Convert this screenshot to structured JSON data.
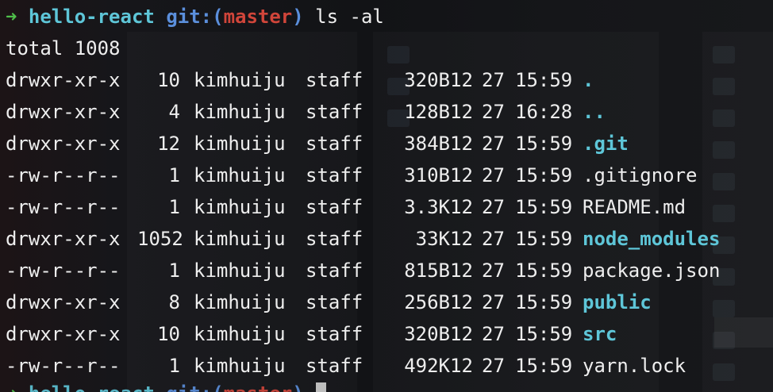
{
  "prompt": {
    "arrow": "➜",
    "dir": "hello-react",
    "git_prefix": "git:(",
    "branch": "master",
    "git_suffix": ")",
    "command": "ls -al"
  },
  "total_line": "total 1008",
  "entries": [
    {
      "perm": "drwxr-xr-x",
      "links": "10",
      "user": "kimhuiju",
      "group": "staff",
      "size": "320B",
      "month": "12",
      "day": "27",
      "time": "15:59",
      "name": "."
    },
    {
      "perm": "drwxr-xr-x",
      "links": "4",
      "user": "kimhuiju",
      "group": "staff",
      "size": "128B",
      "month": "12",
      "day": "27",
      "time": "16:28",
      "name": ".."
    },
    {
      "perm": "drwxr-xr-x",
      "links": "12",
      "user": "kimhuiju",
      "group": "staff",
      "size": "384B",
      "month": "12",
      "day": "27",
      "time": "15:59",
      "name": ".git"
    },
    {
      "perm": "-rw-r--r--",
      "links": "1",
      "user": "kimhuiju",
      "group": "staff",
      "size": "310B",
      "month": "12",
      "day": "27",
      "time": "15:59",
      "name": ".gitignore"
    },
    {
      "perm": "-rw-r--r--",
      "links": "1",
      "user": "kimhuiju",
      "group": "staff",
      "size": "3.3K",
      "month": "12",
      "day": "27",
      "time": "15:59",
      "name": "README.md"
    },
    {
      "perm": "drwxr-xr-x",
      "links": "1052",
      "user": "kimhuiju",
      "group": "staff",
      "size": "33K",
      "month": "12",
      "day": "27",
      "time": "15:59",
      "name": "node_modules"
    },
    {
      "perm": "-rw-r--r--",
      "links": "1",
      "user": "kimhuiju",
      "group": "staff",
      "size": "815B",
      "month": "12",
      "day": "27",
      "time": "15:59",
      "name": "package.json"
    },
    {
      "perm": "drwxr-xr-x",
      "links": "8",
      "user": "kimhuiju",
      "group": "staff",
      "size": "256B",
      "month": "12",
      "day": "27",
      "time": "15:59",
      "name": "public"
    },
    {
      "perm": "drwxr-xr-x",
      "links": "10",
      "user": "kimhuiju",
      "group": "staff",
      "size": "320B",
      "month": "12",
      "day": "27",
      "time": "15:59",
      "name": "src"
    },
    {
      "perm": "-rw-r--r--",
      "links": "1",
      "user": "kimhuiju",
      "group": "staff",
      "size": "492K",
      "month": "12",
      "day": "27",
      "time": "15:59",
      "name": "yarn.lock"
    }
  ],
  "next_prompt": {
    "arrow": "➜",
    "dir": "hello-react",
    "git_prefix": "git:(",
    "branch": "master",
    "git_suffix": ")"
  },
  "colors": {
    "arrow": "#4fbf4a",
    "directory": "#5ec6d8",
    "git": "#5b8fdc",
    "branch": "#d0453a",
    "text": "#eeeeee"
  }
}
